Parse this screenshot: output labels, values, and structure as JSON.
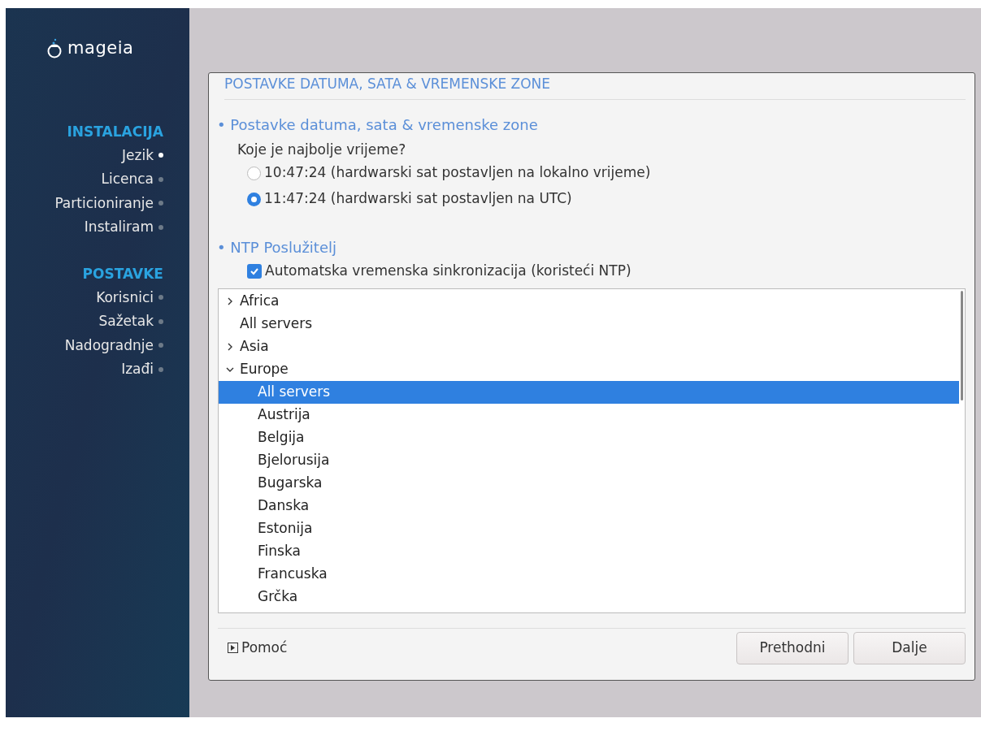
{
  "logo": {
    "text": "mageia"
  },
  "sidebar": {
    "groups": [
      {
        "title": "INSTALACIJA",
        "items": [
          {
            "label": "Jezik",
            "current": true
          },
          {
            "label": "Licenca",
            "current": false
          },
          {
            "label": "Particioniranje",
            "current": false
          },
          {
            "label": "Instaliram",
            "current": false
          }
        ]
      },
      {
        "title": "POSTAVKE",
        "items": [
          {
            "label": "Korisnici",
            "current": false
          },
          {
            "label": "Sažetak",
            "current": false
          },
          {
            "label": "Nadogradnje",
            "current": false
          },
          {
            "label": "Izađi",
            "current": false
          }
        ]
      }
    ]
  },
  "dialog": {
    "title": "POSTAVKE DATUMA, SATA & VREMENSKE ZONE",
    "time_section": {
      "heading": "• Postavke datuma, sata & vremenske zone",
      "question": "Koje je najbolje vrijeme?",
      "options": [
        {
          "label": "10:47:24 (hardwarski sat postavljen na lokalno vrijeme)",
          "selected": false
        },
        {
          "label": "11:47:24 (hardwarski sat postavljen na UTC)",
          "selected": true
        }
      ]
    },
    "ntp_section": {
      "heading": "• NTP Poslužitelj",
      "auto_sync": {
        "label": "Automatska vremenska sinkronizacija (koristeći NTP)",
        "checked": true
      }
    },
    "server_tree": [
      {
        "label": "Africa",
        "expanded": false,
        "selected": false
      },
      {
        "label": "All servers",
        "selected": false
      },
      {
        "label": "Asia",
        "expanded": false,
        "selected": false
      },
      {
        "label": "Europe",
        "expanded": true,
        "selected": false,
        "children": [
          {
            "label": "All servers",
            "selected": true
          },
          {
            "label": "Austrija",
            "selected": false
          },
          {
            "label": "Belgija",
            "selected": false
          },
          {
            "label": "Bjelorusija",
            "selected": false
          },
          {
            "label": "Bugarska",
            "selected": false
          },
          {
            "label": "Danska",
            "selected": false
          },
          {
            "label": "Estonija",
            "selected": false
          },
          {
            "label": "Finska",
            "selected": false
          },
          {
            "label": "Francuska",
            "selected": false
          },
          {
            "label": "Grčka",
            "selected": false
          }
        ]
      }
    ],
    "help": "Pomoć",
    "buttons": [
      "Prethodni",
      "Dalje"
    ]
  }
}
